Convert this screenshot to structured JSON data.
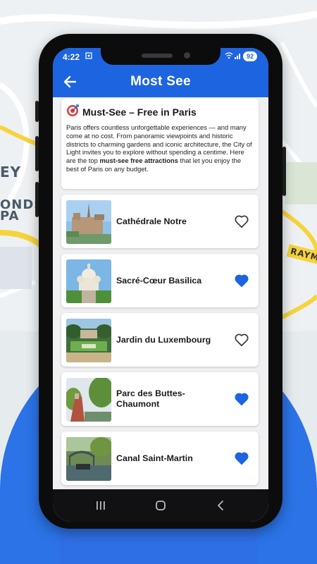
{
  "map": {
    "labels": [
      "EY",
      "ONDS",
      "PA",
      "RAYM"
    ]
  },
  "status_bar": {
    "time": "4:22",
    "battery": "92",
    "notif_icon": "screenshot-icon",
    "wifi_icon": "wifi-icon",
    "signal_icon": "signal-icon"
  },
  "app_bar": {
    "title": "Most See",
    "back_icon": "arrow-left-icon"
  },
  "intro": {
    "emoji": "🎯",
    "title": "Must-See – Free in Paris",
    "text_before": "Paris offers countless unforgettable experiences — and many come at no cost. From panoramic viewpoints and historic districts to charming gardens and iconic architecture, the City of Light invites you to explore without spending a centime. Here are the top ",
    "text_bold": "must-see free attractions",
    "text_after": " that let you enjoy the best of Paris on any budget."
  },
  "places": [
    {
      "name": "Cathédrale Notre",
      "favorite": false,
      "image": "notre-dame-cathedral"
    },
    {
      "name": "Sacré-Cœur Basilica",
      "favorite": true,
      "image": "sacre-coeur-basilica"
    },
    {
      "name": "Jardin du Luxembourg",
      "favorite": false,
      "image": "luxembourg-garden"
    },
    {
      "name": "Parc des Buttes-Chaumont",
      "favorite": true,
      "image": "buttes-chaumont-park"
    },
    {
      "name": "Canal Saint-Martin",
      "favorite": true,
      "image": "canal-saint-martin"
    }
  ],
  "nav_bar": {
    "icons": [
      "recent-apps-icon",
      "home-icon",
      "back-icon"
    ]
  },
  "colors": {
    "primary": "#1d64e0",
    "heart_filled": "#1d64e0",
    "heart_outline": "#333333",
    "background_blue": "#2b73e6",
    "road_yellow": "#f6d33b"
  }
}
